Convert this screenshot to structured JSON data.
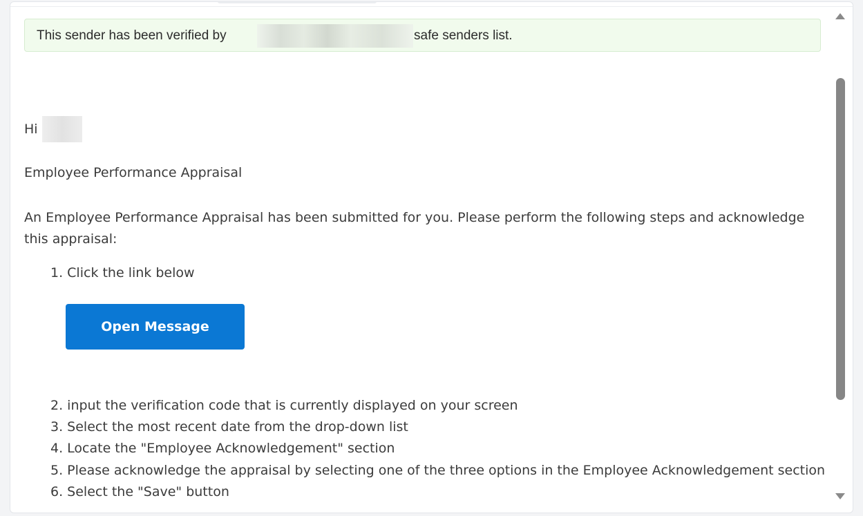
{
  "banner": {
    "text_before": "This sender has been verified by",
    "text_after": "safe senders list.",
    "background": "#f1fbed"
  },
  "email": {
    "greeting": "Hi",
    "heading": "Employee Performance Appraisal",
    "intro": "An Employee Performance Appraisal has been submitted for you. Please perform the following steps and acknowledge this appraisal:",
    "steps": [
      "1. Click the link below",
      "2. input the verification code that is currently displayed on your screen",
      "3. Select the most recent date from the drop-down list",
      "4. Locate the \"Employee Acknowledgement\" section",
      "5. Please acknowledge the appraisal by selecting one of the three options in the Employee Acknowledgement section",
      "6. Select the \"Save\" button"
    ],
    "button_label": "Open Message",
    "button_color": "#0b78d4"
  },
  "icons": {
    "scroll_up": "triangle-up-icon",
    "scroll_down": "triangle-down-icon"
  }
}
